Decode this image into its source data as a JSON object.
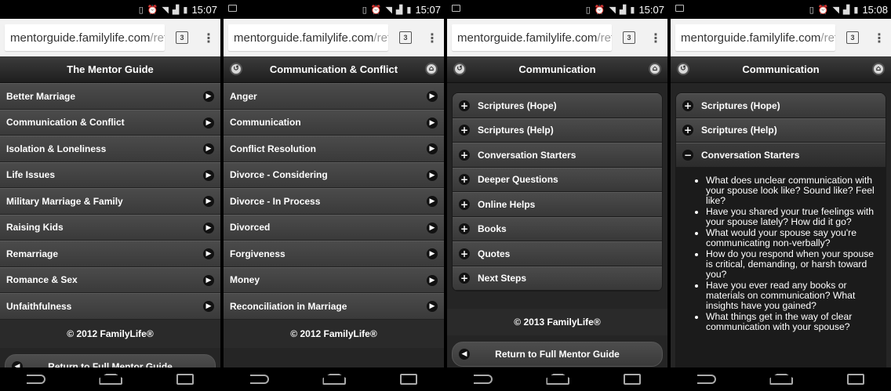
{
  "screens": [
    {
      "status": {
        "time": "15:07"
      },
      "url": {
        "main": "mentorguide.familylife.com",
        "rest": "/refi",
        "tabs": "3"
      },
      "header": {
        "title": "The Mentor Guide"
      },
      "items": [
        "Better Marriage",
        "Communication & Conflict",
        "Isolation & Loneliness",
        "Life Issues",
        "Military Marriage & Family",
        "Raising Kids",
        "Remarriage",
        "Romance & Sex",
        "Unfaithfulness"
      ],
      "footer": "© 2012 FamilyLife®",
      "return_label": "Return to Full Mentor Guide"
    },
    {
      "status": {
        "time": "15:07"
      },
      "url": {
        "main": "mentorguide.familylife.com",
        "rest": "/refi",
        "tabs": "3"
      },
      "header": {
        "title": "Communication & Conflict"
      },
      "items": [
        "Anger",
        "Communication",
        "Conflict Resolution",
        "Divorce - Considering",
        "Divorce - In Process",
        "Divorced",
        "Forgiveness",
        "Money",
        "Reconciliation in Marriage"
      ],
      "footer": "© 2012 FamilyLife®"
    },
    {
      "status": {
        "time": "15:07"
      },
      "url": {
        "main": "mentorguide.familylife.com",
        "rest": "/refi",
        "tabs": "3"
      },
      "header": {
        "title": "Communication"
      },
      "sections": [
        "Scriptures (Hope)",
        "Scriptures (Help)",
        "Conversation Starters",
        "Deeper Questions",
        "Online Helps",
        "Books",
        "Quotes",
        "Next Steps"
      ],
      "footer": "© 2013 FamilyLife®",
      "return_label": "Return to Full Mentor Guide"
    },
    {
      "status": {
        "time": "15:08"
      },
      "url": {
        "main": "mentorguide.familylife.com",
        "rest": "/refi",
        "tabs": "3"
      },
      "header": {
        "title": "Communication"
      },
      "sections": [
        "Scriptures (Hope)",
        "Scriptures (Help)",
        "Conversation Starters"
      ],
      "questions": [
        "What does unclear communication with your spouse look like? Sound like? Feel like?",
        "Have you shared your true feelings with your spouse lately?  How did it go?",
        "What would your spouse say you're communicating non-verbally?",
        "How do you respond when your spouse is critical, demanding, or harsh toward you?",
        "Have you ever read any books or materials on communication? What insights have you gained?",
        "What things get in the way of clear communication with your spouse?"
      ]
    }
  ]
}
